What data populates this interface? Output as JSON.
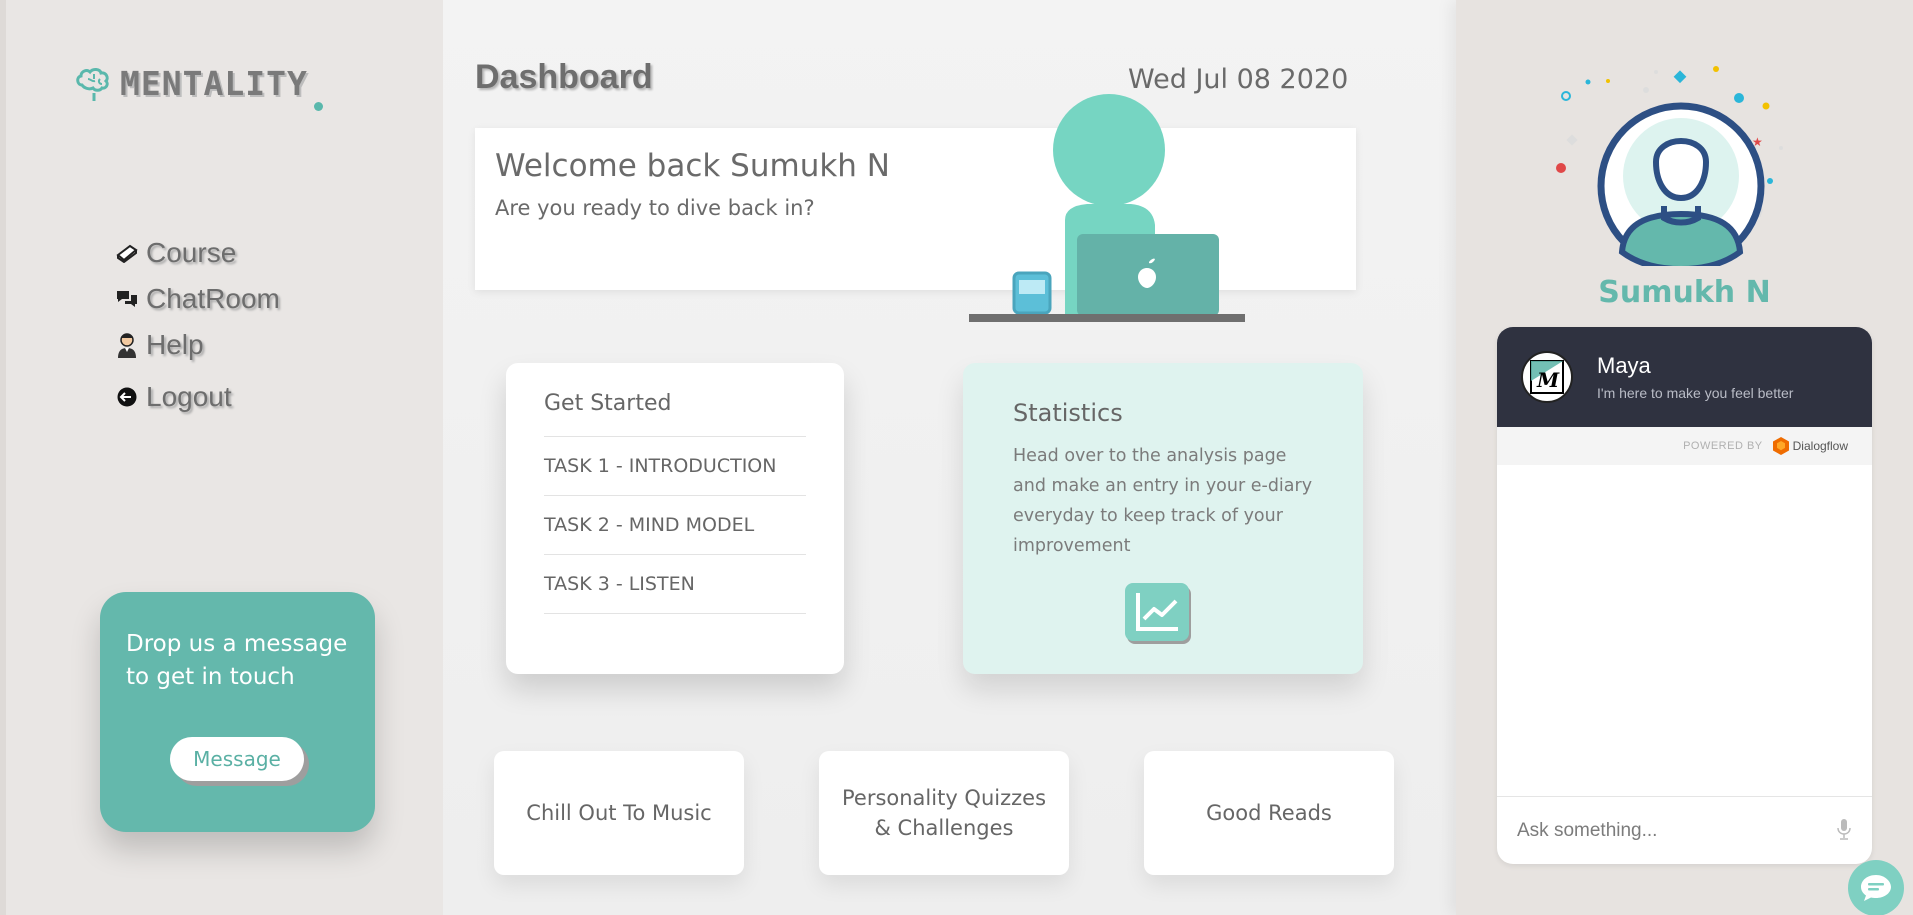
{
  "brand": {
    "name": "MENTALITY",
    "icon": "brain-icon",
    "accent": "#64b8ac"
  },
  "sidebar": {
    "items": [
      {
        "label": "Course",
        "icon": "book-icon"
      },
      {
        "label": "ChatRoom",
        "icon": "chat-bubbles-icon"
      },
      {
        "label": "Help",
        "icon": "person-icon"
      },
      {
        "label": "Logout",
        "icon": "logout-icon"
      }
    ],
    "contact": {
      "text": "Drop us a message to get in touch",
      "button": "Message"
    }
  },
  "header": {
    "title": "Dashboard",
    "date": "Wed Jul 08 2020"
  },
  "welcome": {
    "title": "Welcome back Sumukh N",
    "subtitle": "Are you ready to dive back in?"
  },
  "get_started": {
    "title": "Get Started",
    "tasks": [
      "TASK 1 - INTRODUCTION",
      "TASK 2 - MIND MODEL",
      "TASK 3 - LISTEN"
    ]
  },
  "statistics": {
    "title": "Statistics",
    "description": "Head over to the analysis page and make an entry in your e-diary everyday to keep track of your improvement",
    "icon": "chart-line-icon"
  },
  "tiles": [
    "Chill Out To Music",
    "Personality Quizzes & Challenges",
    "Good Reads"
  ],
  "profile": {
    "name": "Sumukh N"
  },
  "chatbot": {
    "name": "Maya",
    "tagline": "I'm here to make you feel better",
    "powered_by": "POWERED BY",
    "provider": "Dialogflow",
    "placeholder": "Ask something..."
  }
}
